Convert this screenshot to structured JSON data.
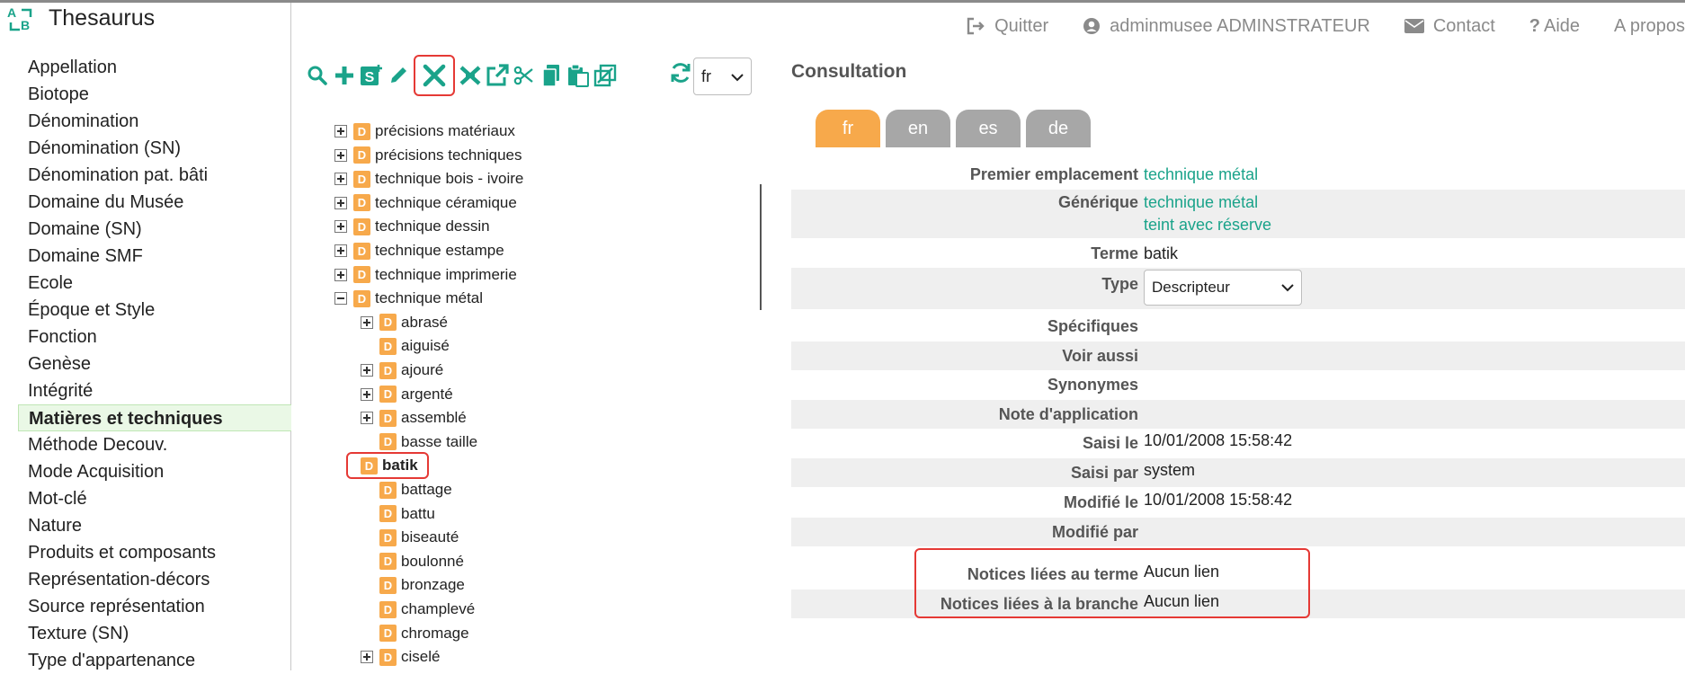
{
  "app": {
    "title": "Thesaurus",
    "logo_letters": [
      "A",
      "B"
    ]
  },
  "topnav": {
    "items": [
      {
        "label": "Quitter",
        "icon": "logout-icon"
      },
      {
        "label": "adminmusee ADMINSTRATEUR",
        "icon": "user-circle-icon"
      },
      {
        "label": "Contact",
        "icon": "envelope-icon"
      },
      {
        "label": "Aide",
        "icon": "question-icon"
      },
      {
        "label": "A propos"
      }
    ]
  },
  "sidebar": {
    "items": [
      {
        "label": "Appellation"
      },
      {
        "label": "Biotope"
      },
      {
        "label": "Dénomination"
      },
      {
        "label": "Dénomination (SN)"
      },
      {
        "label": "Dénomination pat. bâti"
      },
      {
        "label": "Domaine du Musée"
      },
      {
        "label": "Domaine (SN)"
      },
      {
        "label": "Domaine SMF"
      },
      {
        "label": "Ecole"
      },
      {
        "label": "Époque et Style"
      },
      {
        "label": "Fonction"
      },
      {
        "label": "Genèse"
      },
      {
        "label": "Intégrité"
      },
      {
        "label": "Matières et techniques",
        "active": true
      },
      {
        "label": "Méthode Decouv."
      },
      {
        "label": "Mode Acquisition"
      },
      {
        "label": "Mot-clé"
      },
      {
        "label": "Nature"
      },
      {
        "label": "Produits et composants"
      },
      {
        "label": "Représentation-décors"
      },
      {
        "label": "Source représentation"
      },
      {
        "label": "Texture (SN)"
      },
      {
        "label": "Type d'appartenance"
      }
    ]
  },
  "toolbar": {
    "icons": [
      "search-icon",
      "add-icon",
      "add-specific-icon",
      "edit-icon",
      "delete-icon",
      "cut-branch-icon",
      "external-link-icon",
      "scissors-icon",
      "copy-icon",
      "paste-icon",
      "merge-icon",
      "refresh-icon"
    ],
    "language": "fr"
  },
  "tree": {
    "badge": "D",
    "nodes": [
      {
        "label": "précisions matériaux",
        "level": 0,
        "toggle": "plus"
      },
      {
        "label": "précisions techniques",
        "level": 0,
        "toggle": "plus"
      },
      {
        "label": "technique bois - ivoire",
        "level": 0,
        "toggle": "plus"
      },
      {
        "label": "technique céramique",
        "level": 0,
        "toggle": "plus"
      },
      {
        "label": "technique dessin",
        "level": 0,
        "toggle": "plus"
      },
      {
        "label": "technique estampe",
        "level": 0,
        "toggle": "plus"
      },
      {
        "label": "technique imprimerie",
        "level": 0,
        "toggle": "plus"
      },
      {
        "label": "technique métal",
        "level": 0,
        "toggle": "minus"
      },
      {
        "label": "abrasé",
        "level": 1,
        "toggle": "plus"
      },
      {
        "label": "aiguisé",
        "level": 1,
        "toggle": "none"
      },
      {
        "label": "ajouré",
        "level": 1,
        "toggle": "plus"
      },
      {
        "label": "argenté",
        "level": 1,
        "toggle": "plus"
      },
      {
        "label": "assemblé",
        "level": 1,
        "toggle": "plus"
      },
      {
        "label": "basse taille",
        "level": 1,
        "toggle": "none"
      },
      {
        "label": "batik",
        "level": 1,
        "toggle": "none",
        "selected": true
      },
      {
        "label": "battage",
        "level": 1,
        "toggle": "none"
      },
      {
        "label": "battu",
        "level": 1,
        "toggle": "none"
      },
      {
        "label": "biseauté",
        "level": 1,
        "toggle": "none"
      },
      {
        "label": "boulonné",
        "level": 1,
        "toggle": "none"
      },
      {
        "label": "bronzage",
        "level": 1,
        "toggle": "none"
      },
      {
        "label": "champlevé",
        "level": 1,
        "toggle": "none"
      },
      {
        "label": "chromage",
        "level": 1,
        "toggle": "none"
      },
      {
        "label": "ciselé",
        "level": 1,
        "toggle": "plus"
      }
    ]
  },
  "consultation": {
    "title": "Consultation",
    "tabs": [
      {
        "label": "fr",
        "active": true
      },
      {
        "label": "en"
      },
      {
        "label": "es"
      },
      {
        "label": "de"
      }
    ],
    "fields": {
      "premier_emplacement": {
        "label": "Premier emplacement",
        "value": "technique métal"
      },
      "generique": {
        "label": "Générique",
        "values": [
          "technique métal",
          "teint avec réserve"
        ]
      },
      "terme": {
        "label": "Terme",
        "value": "batik"
      },
      "type": {
        "label": "Type",
        "value": "Descripteur"
      },
      "specifiques": {
        "label": "Spécifiques",
        "value": ""
      },
      "voir_aussi": {
        "label": "Voir aussi",
        "value": ""
      },
      "synonymes": {
        "label": "Synonymes",
        "value": ""
      },
      "note_application": {
        "label": "Note d'application",
        "value": ""
      },
      "saisi_le": {
        "label": "Saisi le",
        "value": "10/01/2008 15:58:42"
      },
      "saisi_par": {
        "label": "Saisi par",
        "value": "system"
      },
      "modifie_le": {
        "label": "Modifié le",
        "value": "10/01/2008 15:58:42"
      },
      "modifie_par": {
        "label": "Modifié par",
        "value": ""
      },
      "notices_terme": {
        "label": "Notices liées au terme",
        "value": "Aucun lien"
      },
      "notices_branche": {
        "label": "Notices liées à la branche",
        "value": "Aucun lien"
      }
    }
  },
  "colors": {
    "accent": "#1aa38a",
    "tab_active": "#f7a94b",
    "tab_inactive": "#a7a7a7",
    "highlight": "#e53935",
    "badge": "#f7a94b"
  }
}
